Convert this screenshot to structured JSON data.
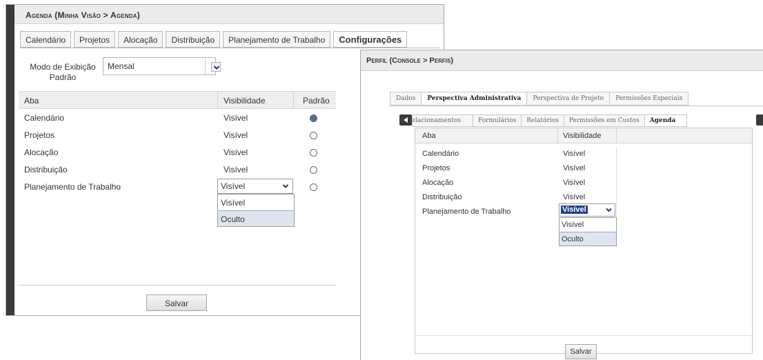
{
  "left": {
    "title": "Agenda (Minha Visão > Agenda)",
    "tabs": [
      "Calendário",
      "Projetos",
      "Alocação",
      "Distribuição",
      "Planejamento de Trabalho",
      "Configurações"
    ],
    "active_tab": "Configurações",
    "mode_label": "Modo de Exibição Padrão",
    "mode_value": "Mensal",
    "columns": {
      "aba": "Aba",
      "visibilidade": "Visibilidade",
      "padrao": "Padrão"
    },
    "rows": [
      {
        "aba": "Calendário",
        "visibilidade": "Visível",
        "padrao": true
      },
      {
        "aba": "Projetos",
        "visibilidade": "Visível",
        "padrao": false
      },
      {
        "aba": "Alocação",
        "visibilidade": "Visível",
        "padrao": false
      },
      {
        "aba": "Distribuição",
        "visibilidade": "Visível",
        "padrao": false
      },
      {
        "aba": "Planejamento de Trabalho",
        "visibilidade": "Visível",
        "padrao": false
      }
    ],
    "dropdown": {
      "value": "Visível",
      "options": [
        "Visível",
        "Oculto"
      ],
      "highlighted": "Oculto"
    },
    "save_label": "Salvar"
  },
  "right": {
    "title": "Perfil (Console > Perfis)",
    "outer_tabs": [
      "Dados",
      "Perspectiva Administrativa",
      "Perspectiva de Projeto",
      "Permissões Especiais"
    ],
    "active_outer_tab": "Perspectiva Administrativa",
    "inner_tabs": [
      "Relacionamentos",
      "Formulários",
      "Relatórios",
      "Permissões em Custos",
      "Agenda"
    ],
    "active_inner_tab": "Agenda",
    "columns": {
      "aba": "Aba",
      "visibilidade": "Visibilidade"
    },
    "rows": [
      {
        "aba": "Calendário",
        "visibilidade": "Visível"
      },
      {
        "aba": "Projetos",
        "visibilidade": "Visível"
      },
      {
        "aba": "Alocação",
        "visibilidade": "Visível"
      },
      {
        "aba": "Distribuição",
        "visibilidade": "Visível"
      },
      {
        "aba": "Planejamento de Trabalho",
        "visibilidade": "Visível"
      }
    ],
    "dropdown": {
      "value": "Visível",
      "options": [
        "Visível",
        "Oculto"
      ],
      "highlighted": "Oculto"
    },
    "save_label": "Salvar"
  },
  "icons": {
    "dropdown_arrow": "chevron-down-icon",
    "scroll_left": "arrow-left-icon",
    "scroll_right": "arrow-right-icon",
    "radio": "radio-icon"
  },
  "colors": {
    "titlebar_dark": "#3a3a3a",
    "selection": "#1f3f8f",
    "highlight": "#dfe5ef",
    "radio": "#5a6a8a"
  }
}
